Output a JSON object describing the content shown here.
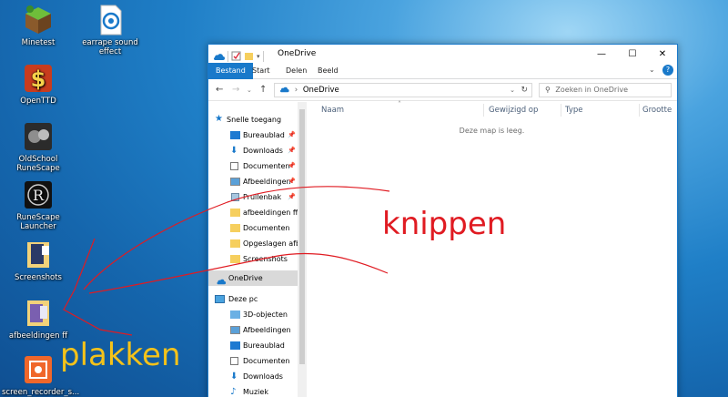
{
  "desktop": {
    "icons": [
      {
        "label": "Minetest"
      },
      {
        "label": "earrape sound effect"
      },
      {
        "label": "OpenTTD"
      },
      {
        "label": "OldSchool RuneScape"
      },
      {
        "label": "RuneScape Launcher"
      },
      {
        "label": "Screenshots"
      },
      {
        "label": "afbeeldingen ff"
      },
      {
        "label": "screen_recorder_s..."
      }
    ]
  },
  "window": {
    "title": "OneDrive",
    "controls": {
      "minimize": "—",
      "maximize": "☐",
      "close": "✕"
    },
    "ribbon_tabs": [
      "Bestand",
      "Start",
      "Delen",
      "Beeld"
    ],
    "address": {
      "path": "OneDrive",
      "search_placeholder": "Zoeken in OneDrive"
    },
    "nav": {
      "quick_access": "Snelle toegang",
      "quick_items": [
        "Bureaublad",
        "Downloads",
        "Documenten",
        "Afbeeldingen",
        "Prullenbak"
      ],
      "folders": [
        "afbeeldingen ff",
        "Documenten",
        "Opgeslagen afbe",
        "Screenshots"
      ],
      "onedrive": "OneDrive",
      "this_pc": "Deze pc",
      "pc_items": [
        "3D-objecten",
        "Afbeeldingen",
        "Bureaublad",
        "Documenten",
        "Downloads",
        "Muziek"
      ]
    },
    "columns": [
      "Naam",
      "Gewijzigd op",
      "Type",
      "Grootte"
    ],
    "empty_message": "Deze map is leeg."
  },
  "annotations": {
    "cut": "knippen",
    "paste": "plakken"
  },
  "colors": {
    "accent": "#1979ca",
    "cut_annotation": "#e01b22",
    "paste_annotation": "#f4c21a"
  }
}
